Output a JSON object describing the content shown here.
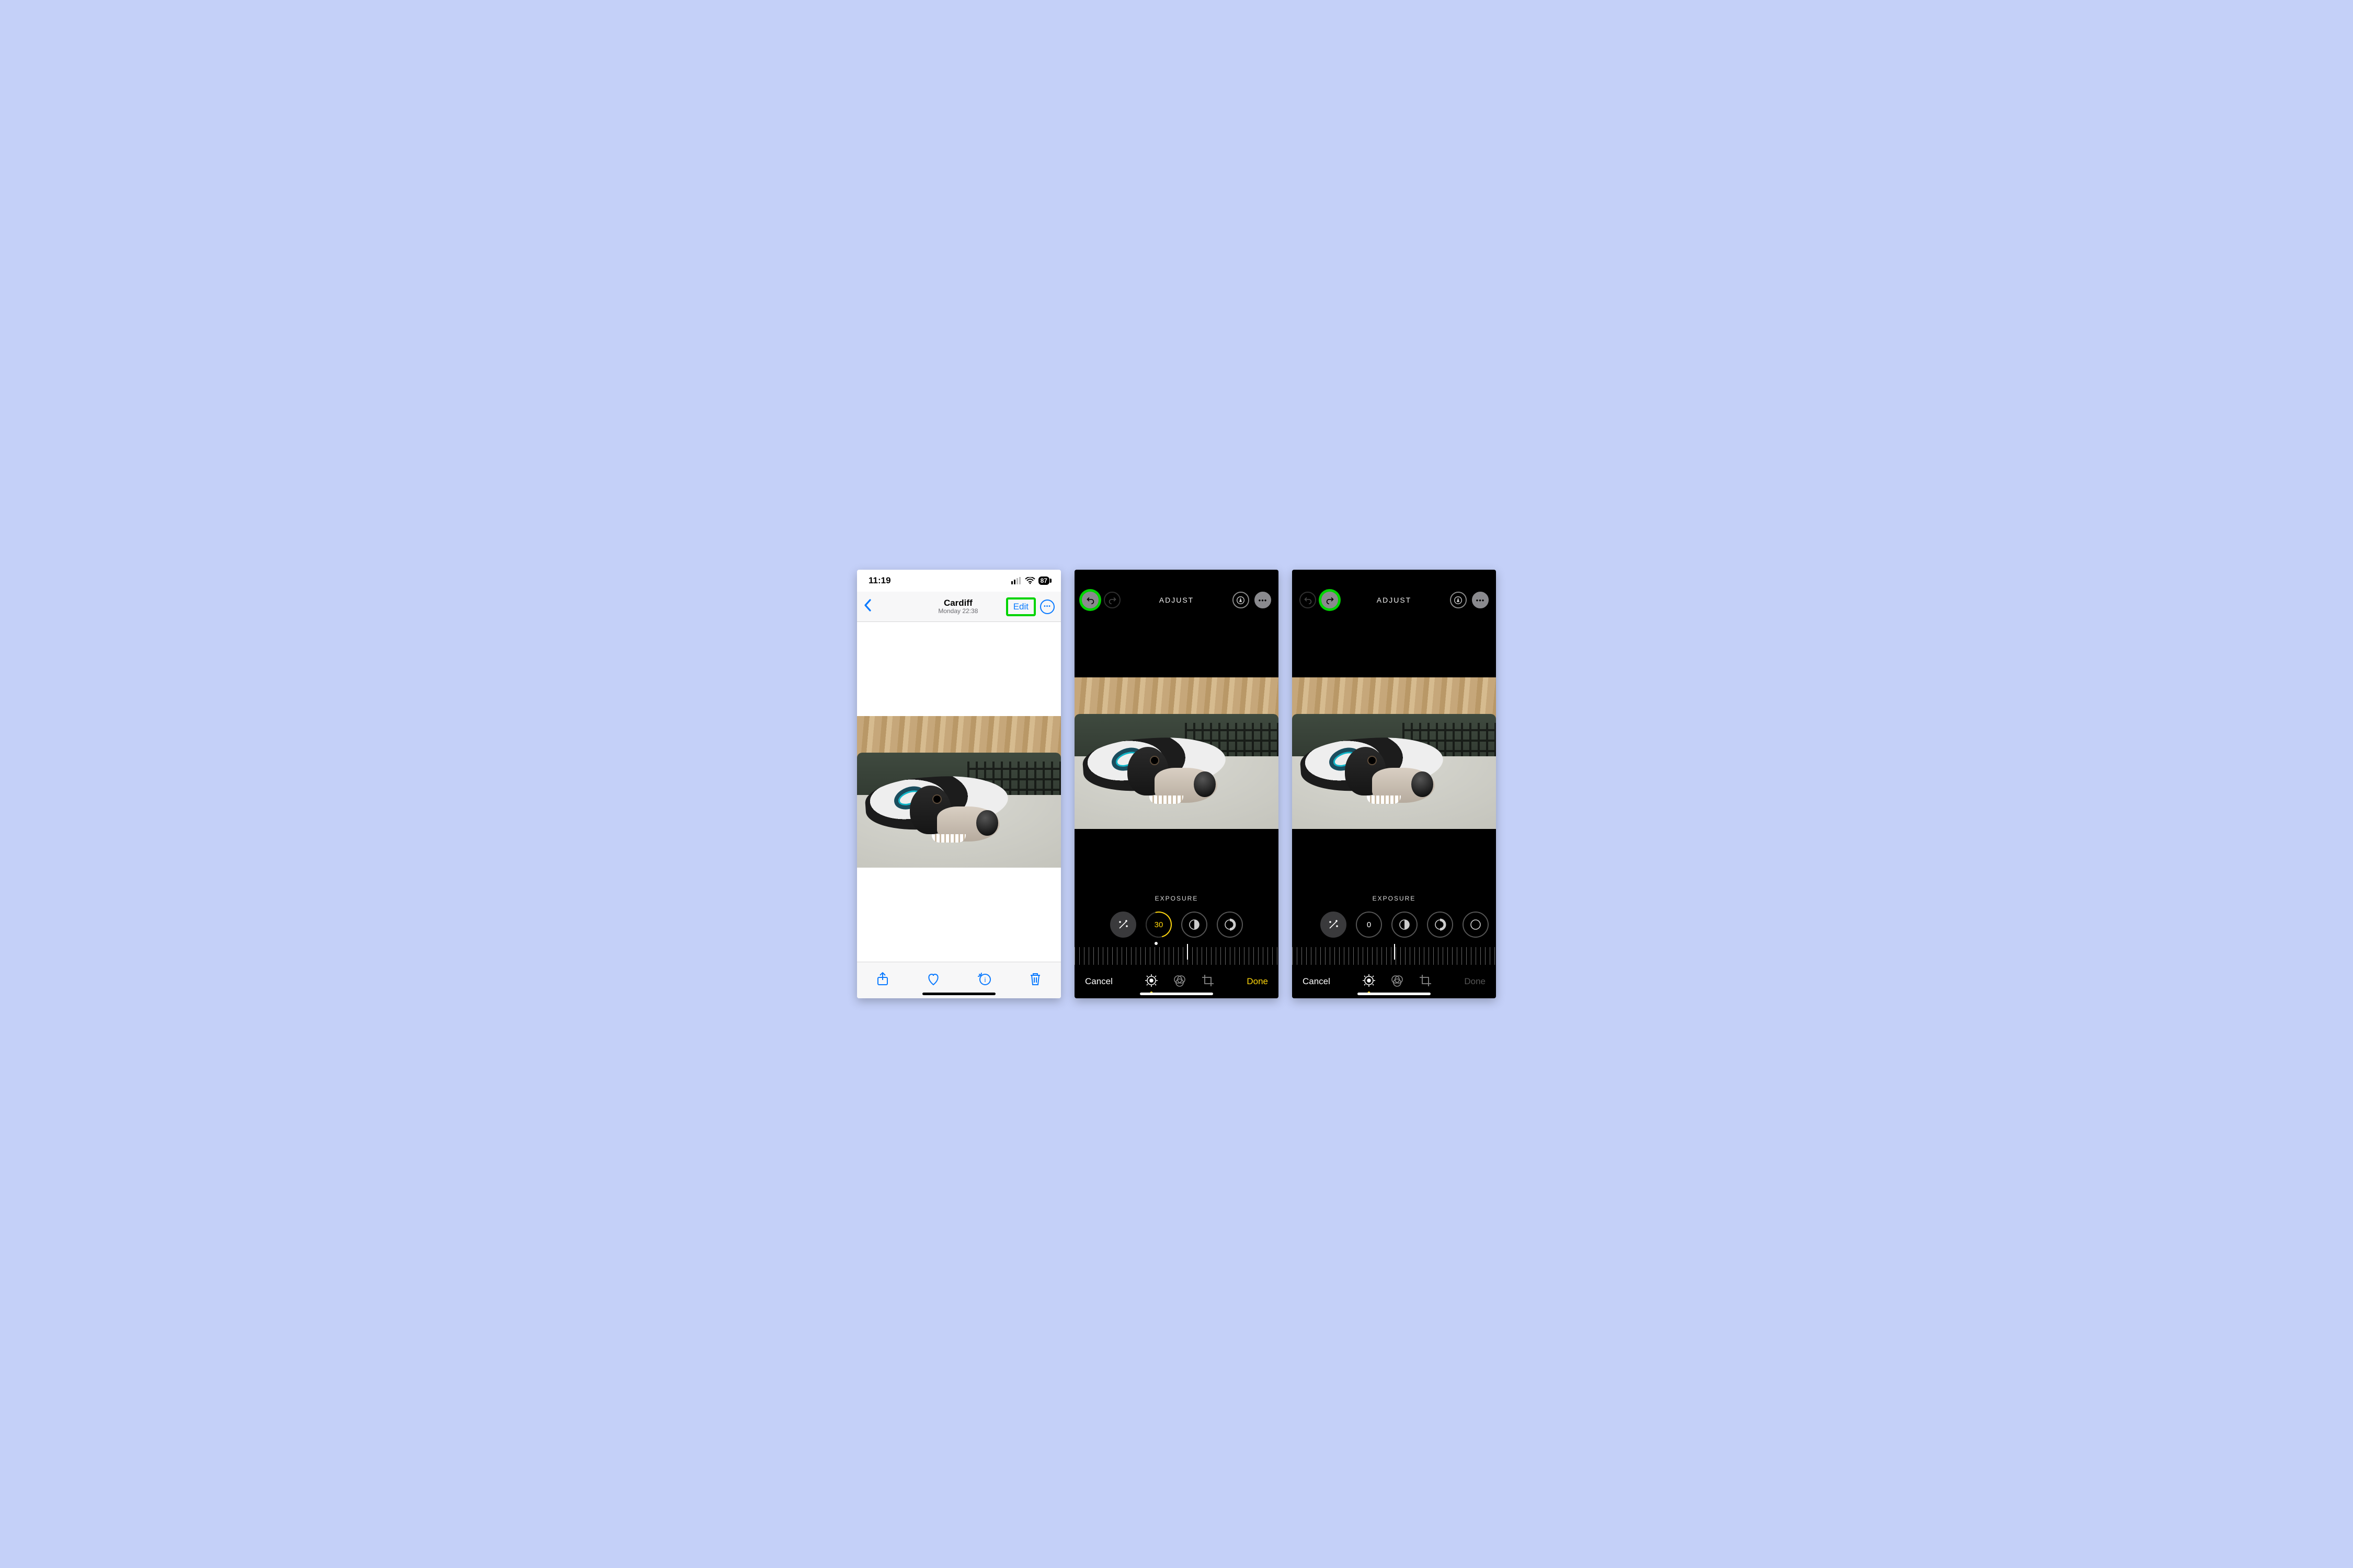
{
  "panel1": {
    "status_time": "11:19",
    "battery_pct": "87",
    "location_title": "Cardiff",
    "date_line": "Monday  22:38",
    "edit_label": "Edit",
    "toolbar": {
      "share": "share-icon",
      "favorite": "heart-icon",
      "info": "info-sparkle-icon",
      "trash": "trash-icon"
    }
  },
  "panel2": {
    "mode": "ADJUST",
    "param": "EXPOSURE",
    "value": "30",
    "cancel": "Cancel",
    "done": "Done",
    "undo_enabled": true,
    "redo_enabled": false,
    "ruler_cursor_pct": 55,
    "ruler_dot_pct": 40
  },
  "panel3": {
    "mode": "ADJUST",
    "param": "EXPOSURE",
    "value": "0",
    "cancel": "Cancel",
    "done": "Done",
    "undo_enabled": false,
    "redo_enabled": true,
    "ruler_cursor_pct": 50
  }
}
